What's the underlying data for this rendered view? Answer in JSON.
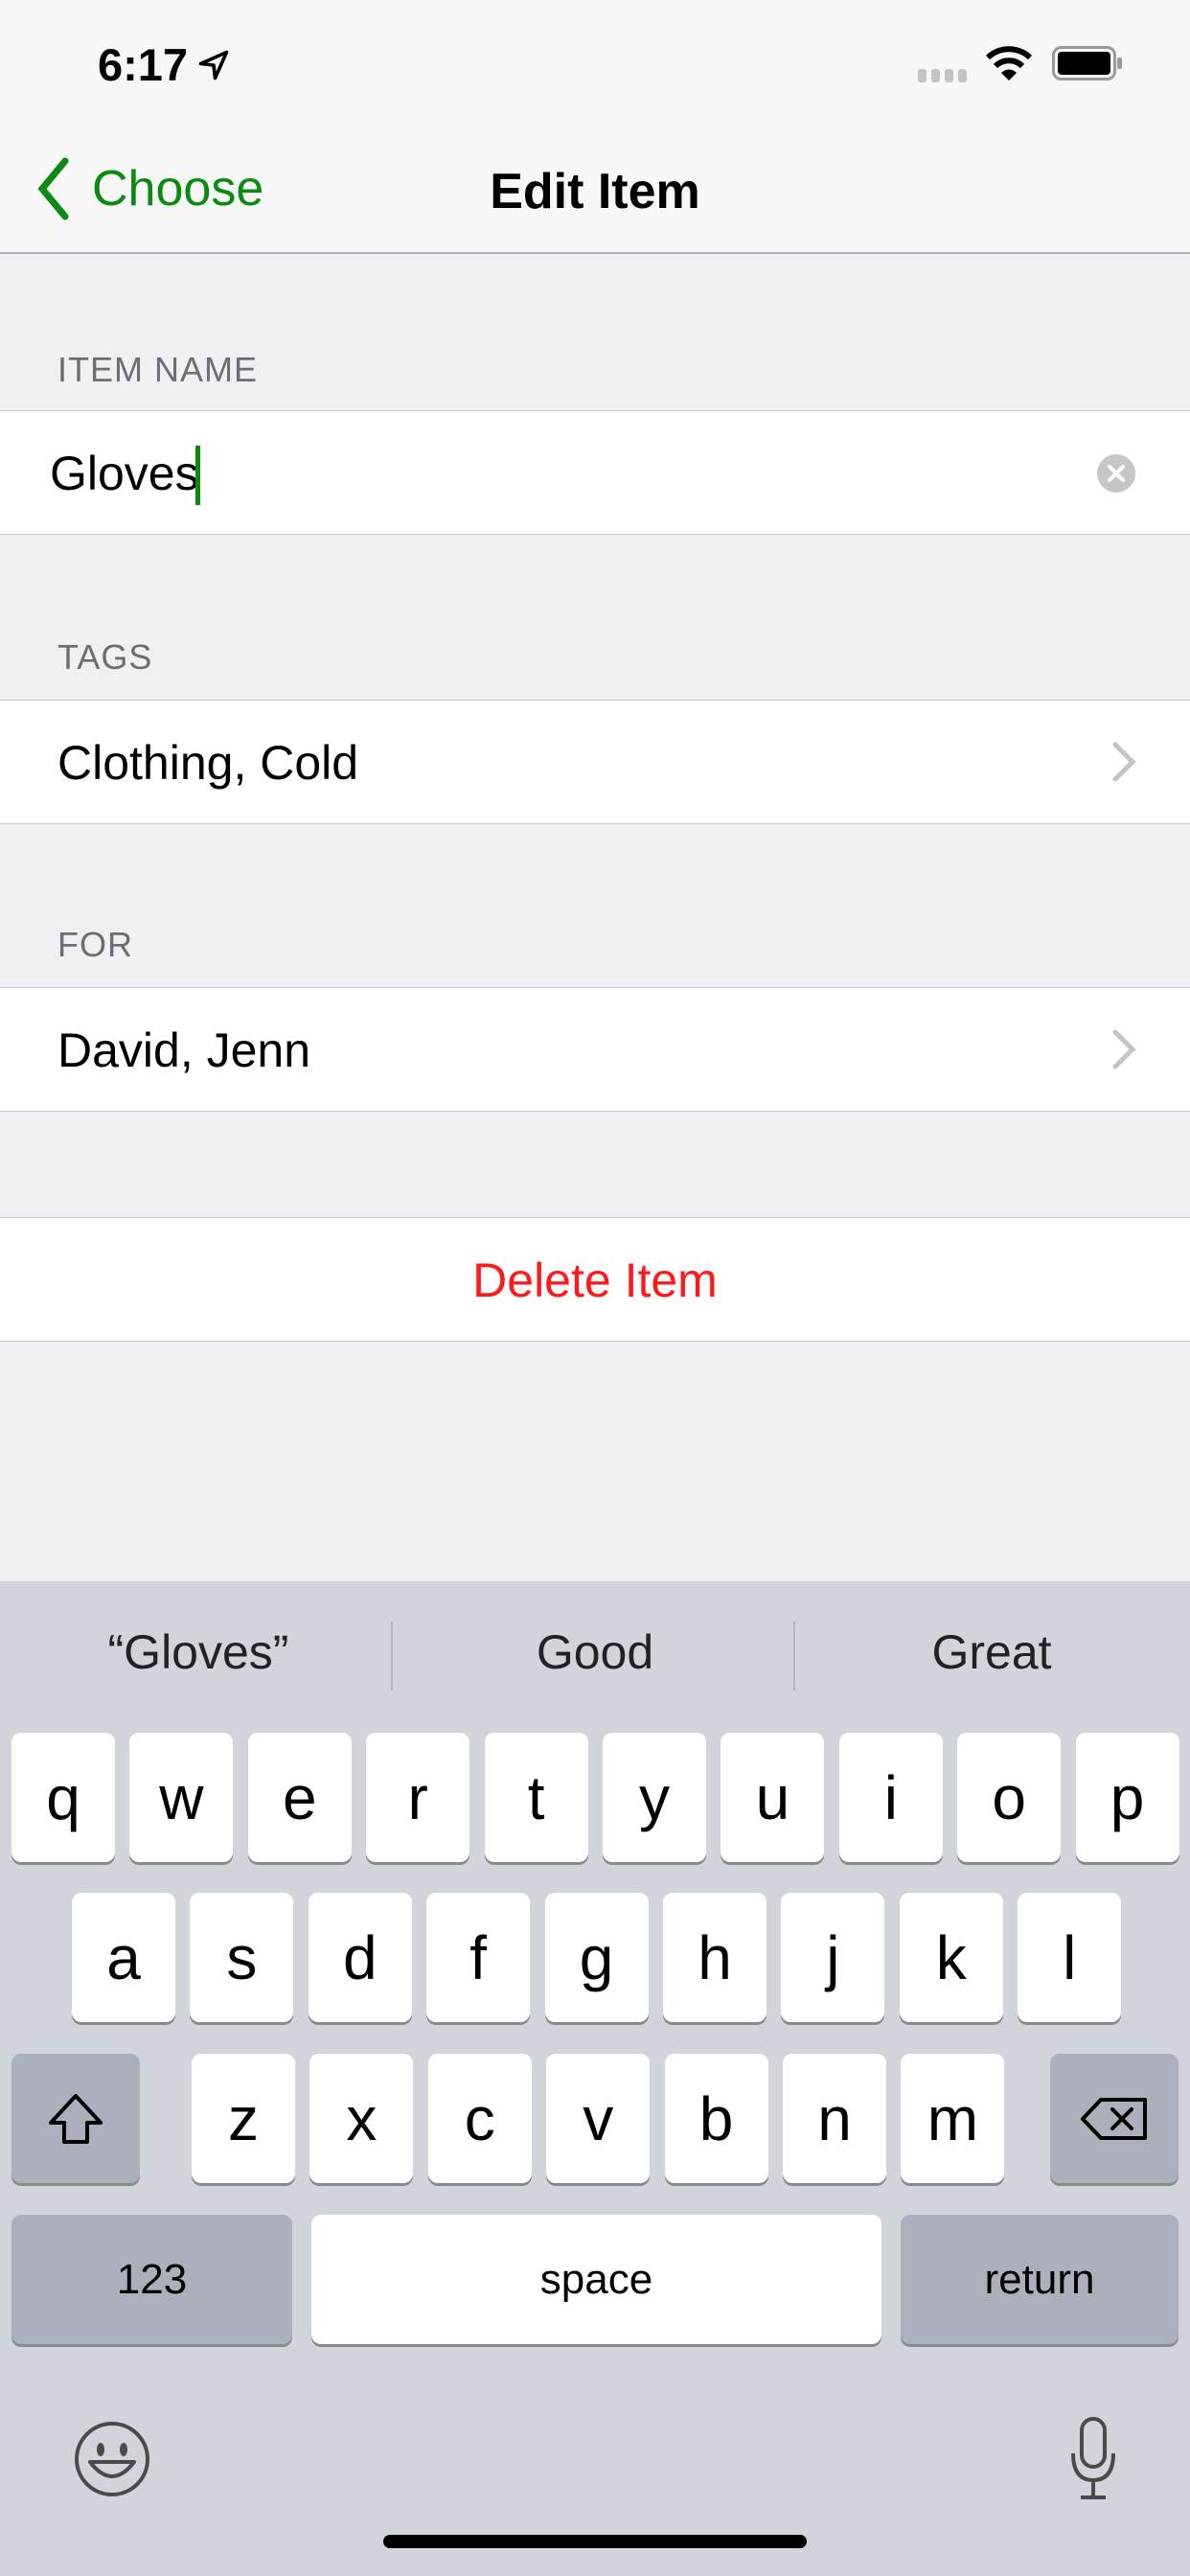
{
  "status_bar": {
    "time": "6:17",
    "icons": [
      "location-arrow-icon",
      "cellular-signal-icon",
      "wifi-icon",
      "battery-icon"
    ]
  },
  "nav": {
    "back_label": "Choose",
    "title": "Edit Item",
    "accent_color": "#0a8a10"
  },
  "sections": {
    "item_name": {
      "header": "ITEM NAME",
      "value": "Gloves"
    },
    "tags": {
      "header": "TAGS",
      "value": "Clothing, Cold"
    },
    "for": {
      "header": "FOR",
      "value": "David, Jenn"
    }
  },
  "delete": {
    "label": "Delete Item",
    "color": "#ff1a1a"
  },
  "keyboard": {
    "suggestions": [
      "“Gloves”",
      "Good",
      "Great"
    ],
    "rows": [
      [
        "q",
        "w",
        "e",
        "r",
        "t",
        "y",
        "u",
        "i",
        "o",
        "p"
      ],
      [
        "a",
        "s",
        "d",
        "f",
        "g",
        "h",
        "j",
        "k",
        "l"
      ],
      [
        "z",
        "x",
        "c",
        "v",
        "b",
        "n",
        "m"
      ]
    ],
    "numbers_label": "123",
    "space_label": "space",
    "return_label": "return"
  }
}
